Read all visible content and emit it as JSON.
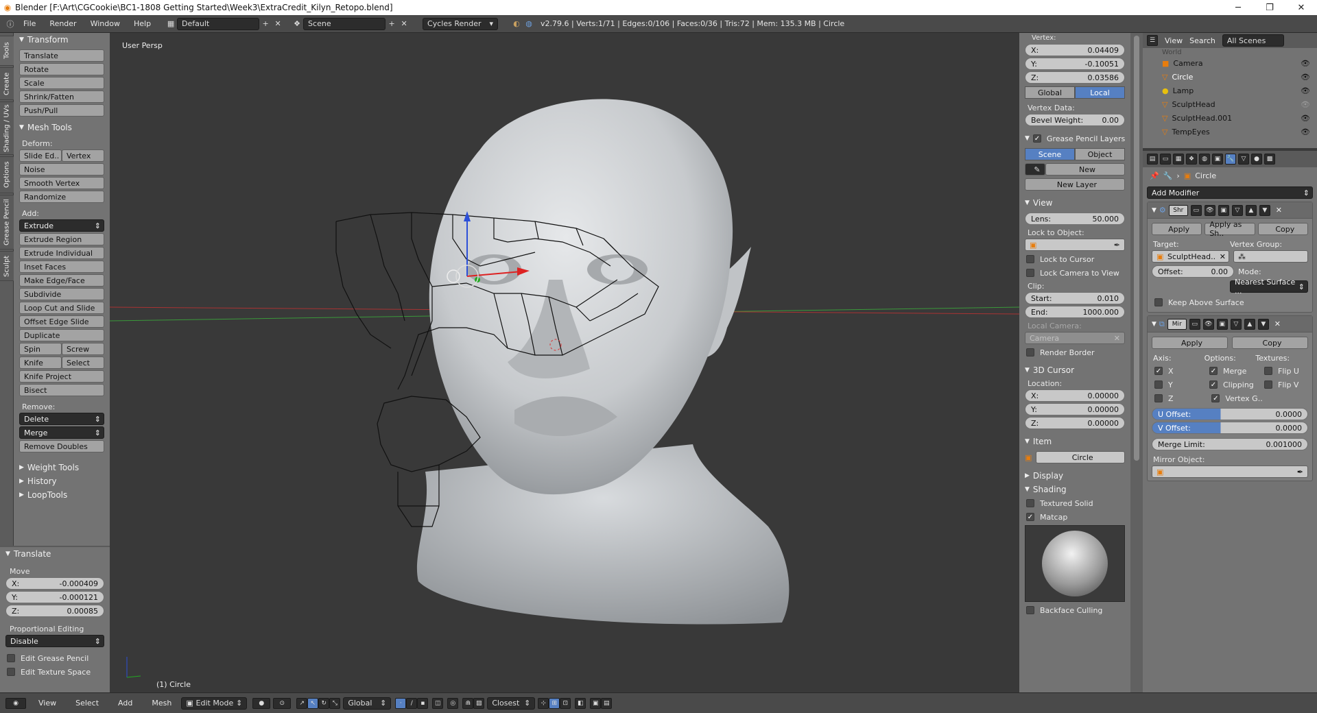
{
  "window": {
    "title": "Blender [F:\\Art\\CGCookie\\BC1-1808 Getting Started\\Week3\\ExtraCredit_Kilyn_Retopo.blend]",
    "minimize": "─",
    "maximize": "❐",
    "close": "✕"
  },
  "infobar": {
    "menus": [
      "File",
      "Render",
      "Window",
      "Help"
    ],
    "layout": "Default",
    "scene": "Scene",
    "engine": "Cycles Render",
    "stats": "v2.79.6 | Verts:1/71 | Edges:0/106 | Faces:0/36 | Tris:72 | Mem: 135.3 MB | Circle"
  },
  "tooltabs": [
    "Tools",
    "Create",
    "Shading / UVs",
    "Options",
    "Grease Pencil",
    "Sculpt"
  ],
  "tools": {
    "transform_header": "Transform",
    "transform": [
      "Translate",
      "Rotate",
      "Scale",
      "Shrink/Fatten",
      "Push/Pull"
    ],
    "mesh_header": "Mesh Tools",
    "deform_label": "Deform:",
    "slide_edge": "Slide Ed..",
    "vertex": "Vertex",
    "deform": [
      "Noise",
      "Smooth Vertex",
      "Randomize"
    ],
    "add_label": "Add:",
    "extrude": "Extrude",
    "add": [
      "Extrude Region",
      "Extrude Individual",
      "Inset Faces",
      "Make Edge/Face",
      "Subdivide",
      "Loop Cut and Slide",
      "Offset Edge Slide",
      "Duplicate"
    ],
    "spin": "Spin",
    "screw": "Screw",
    "knife": "Knife",
    "select": "Select",
    "add2": [
      "Knife Project",
      "Bisect"
    ],
    "remove_label": "Remove:",
    "delete": "Delete",
    "merge": "Merge",
    "remove_doubles": "Remove Doubles",
    "collapsed": [
      "Weight Tools",
      "History",
      "LoopTools"
    ]
  },
  "operator": {
    "header": "Translate",
    "move_label": "Move",
    "x": "X:",
    "x_val": "-0.000409",
    "y": "Y:",
    "y_val": "-0.000121",
    "z": "Z:",
    "z_val": "0.00085",
    "prop_label": "Proportional Editing",
    "prop_val": "Disable",
    "edit_grease": "Edit Grease Pencil",
    "edit_texture": "Edit Texture Space"
  },
  "viewport": {
    "view_name": "User Persp",
    "object_label": "(1) Circle"
  },
  "npanel": {
    "vertex_label": "Vertex:",
    "vx": "X:",
    "vx_val": "0.04409",
    "vy": "Y:",
    "vy_val": "-0.10051",
    "vz": "Z:",
    "vz_val": "0.03586",
    "global": "Global",
    "local": "Local",
    "vertex_data": "Vertex Data:",
    "bevel": "Bevel Weight:",
    "bevel_val": "0.00",
    "gp_header": "Grease Pencil Layers",
    "scene": "Scene",
    "object": "Object",
    "new": "New",
    "new_layer": "New Layer",
    "view_header": "View",
    "lens": "Lens:",
    "lens_val": "50.000",
    "lock_obj": "Lock to Object:",
    "lock_cursor": "Lock to Cursor",
    "lock_camera": "Lock Camera to View",
    "clip": "Clip:",
    "start": "Start:",
    "start_val": "0.010",
    "end": "End:",
    "end_val": "1000.000",
    "local_camera": "Local Camera:",
    "camera": "Camera",
    "render_border": "Render Border",
    "cursor_header": "3D Cursor",
    "location": "Location:",
    "cx": "X:",
    "cx_val": "0.00000",
    "cy": "Y:",
    "cy_val": "0.00000",
    "cz": "Z:",
    "cz_val": "0.00000",
    "item_header": "Item",
    "item_name": "Circle",
    "display_header": "Display",
    "shading_header": "Shading",
    "textured_solid": "Textured Solid",
    "matcap": "Matcap",
    "backface": "Backface Culling"
  },
  "outliner": {
    "view": "View",
    "search": "Search",
    "filter": "All Scenes",
    "world": "World",
    "items": [
      "Camera",
      "Circle",
      "Lamp",
      "SculptHead",
      "SculptHead.001",
      "TempEyes"
    ]
  },
  "properties": {
    "object_name": "Circle",
    "add_modifier": "Add Modifier",
    "shrink": {
      "name": "Shr",
      "apply": "Apply",
      "apply_shape": "Apply as Sh..",
      "copy": "Copy",
      "target_label": "Target:",
      "target": "SculptHead..",
      "vgroup_label": "Vertex Group:",
      "offset": "Offset:",
      "offset_val": "0.00",
      "mode_label": "Mode:",
      "mode": "Nearest Surface ...",
      "keep_above": "Keep Above Surface"
    },
    "mirror": {
      "name": "Mir",
      "apply": "Apply",
      "copy": "Copy",
      "axis": "Axis:",
      "options": "Options:",
      "textures": "Textures:",
      "x": "X",
      "y": "Y",
      "z": "Z",
      "merge": "Merge",
      "clipping": "Clipping",
      "vertex_groups": "Vertex G..",
      "flip_u": "Flip U",
      "flip_v": "Flip V",
      "u_offset": "U Offset:",
      "u_val": "0.0000",
      "v_offset": "V Offset:",
      "v_val": "0.0000",
      "merge_limit": "Merge Limit:",
      "merge_val": "0.001000",
      "mirror_object": "Mirror Object:"
    }
  },
  "footer": {
    "menus": [
      "View",
      "Select",
      "Add",
      "Mesh"
    ],
    "mode": "Edit Mode",
    "orientation": "Global",
    "snap": "Closest"
  },
  "colors": {
    "accent": "#5680c2",
    "axis_red": "#b33",
    "axis_green": "#3a3",
    "blender_orange": "#e87d0d"
  }
}
